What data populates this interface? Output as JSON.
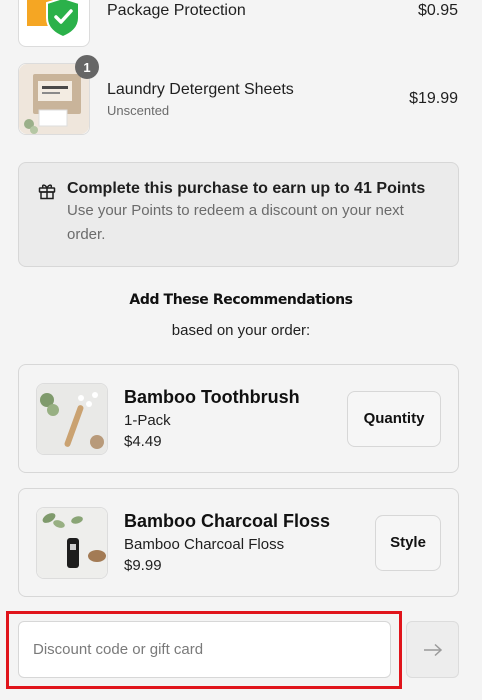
{
  "line_items": [
    {
      "title": "Package Protection",
      "subtitle": "",
      "price": "$0.95",
      "quantity": ""
    },
    {
      "title": "Laundry Detergent Sheets",
      "subtitle": "Unscented",
      "price": "$19.99",
      "quantity": "1"
    }
  ],
  "points": {
    "title": "Complete this purchase to earn up to 41 Points",
    "description": "Use your Points to redeem a discount on your next order.",
    "icon": "gift-icon"
  },
  "recommendations": {
    "heading": "Add These Recommendations",
    "subheading": "based on your order:",
    "items": [
      {
        "title": "Bamboo Toothbrush",
        "variant": "1-Pack",
        "price": "$4.49",
        "button": "Quantity"
      },
      {
        "title": "Bamboo Charcoal Floss",
        "variant": "Bamboo Charcoal Floss",
        "price": "$9.99",
        "button": "Style"
      }
    ]
  },
  "discount": {
    "placeholder": "Discount code or gift card",
    "value": "",
    "apply_icon": "arrow-right-icon"
  },
  "colors": {
    "background": "#f4f4f4",
    "highlight": "#e0141b",
    "shield_green": "#2bb14a",
    "box_orange": "#f5a623"
  }
}
